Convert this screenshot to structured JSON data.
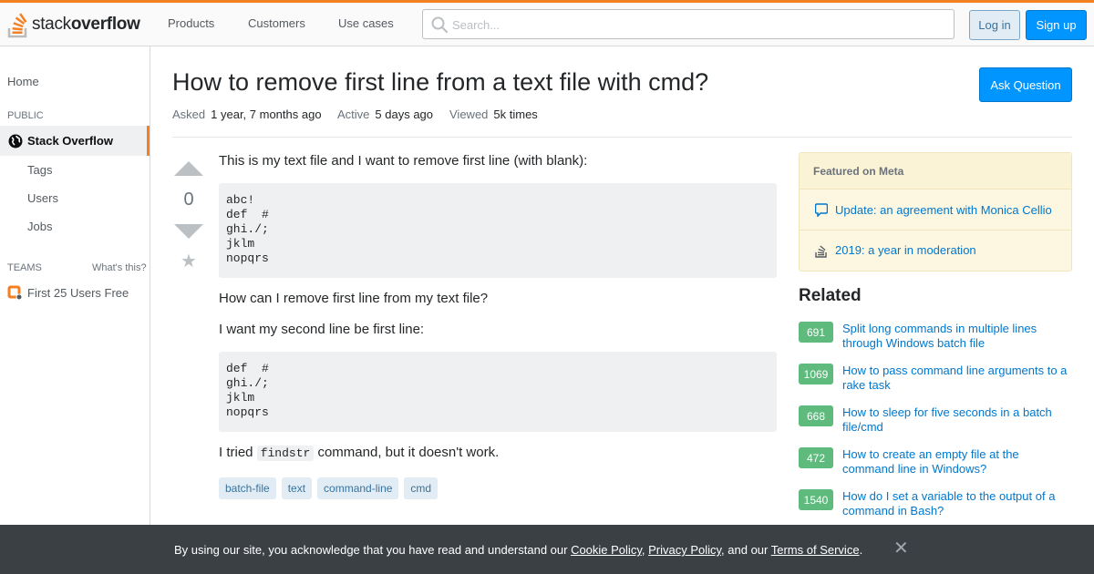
{
  "header": {
    "logo_word1": "stack",
    "logo_word2": "overflow",
    "nav": [
      "Products",
      "Customers",
      "Use cases"
    ],
    "search_placeholder": "Search...",
    "login_label": "Log in",
    "signup_label": "Sign up",
    "accent_color": "#f48024"
  },
  "sidebar": {
    "home": "Home",
    "public_heading": "PUBLIC",
    "active_item": "Stack Overflow",
    "sub_items": [
      "Tags",
      "Users",
      "Jobs"
    ],
    "teams_heading": "TEAMS",
    "whats_this": "What's this?",
    "first_users": "First 25 Users Free"
  },
  "question": {
    "title": "How to remove first line from a text file with cmd?",
    "ask_button": "Ask Question",
    "asked_label": "Asked",
    "asked_value": "1 year, 7 months ago",
    "active_label": "Active",
    "active_value": "5 days ago",
    "viewed_label": "Viewed",
    "viewed_value": "5k times",
    "votes": "0",
    "para1": "This is my text file and I want to remove first line (with blank):",
    "code1": "abc!\ndef  #\nghi./;\njklm\nnopqrs",
    "para2": "How can I remove first line from my text file?",
    "para3": "I want my second line be first line:",
    "code2": "def  #\nghi./;\njklm\nnopqrs",
    "para4_before": "I tried ",
    "para4_code": "findstr",
    "para4_after": " command, but it doesn't work.",
    "tags": [
      "batch-file",
      "text",
      "command-line",
      "cmd"
    ]
  },
  "featured": {
    "heading": "Featured on Meta",
    "items": [
      {
        "icon": "chat-bubble-icon",
        "text": "Update: an agreement with Monica Cellio"
      },
      {
        "icon": "stack-overflow-icon",
        "text": "2019: a year in moderation"
      }
    ]
  },
  "related": {
    "heading": "Related",
    "items": [
      {
        "score": "691",
        "title": "Split long commands in multiple lines through Windows batch file"
      },
      {
        "score": "1069",
        "title": "How to pass command line arguments to a rake task"
      },
      {
        "score": "668",
        "title": "How to sleep for five seconds in a batch file/cmd"
      },
      {
        "score": "472",
        "title": "How to create an empty file at the command line in Windows?"
      },
      {
        "score": "1540",
        "title": "How do I set a variable to the output of a command in Bash?"
      }
    ]
  },
  "cookie": {
    "text1": "By using our site, you acknowledge that you have read and understand our ",
    "cookie_policy": "Cookie Policy",
    "sep1": ", ",
    "privacy_policy": "Privacy Policy",
    "sep2": ", and our ",
    "terms": "Terms of Service",
    "end": ".",
    "close": "✕"
  }
}
